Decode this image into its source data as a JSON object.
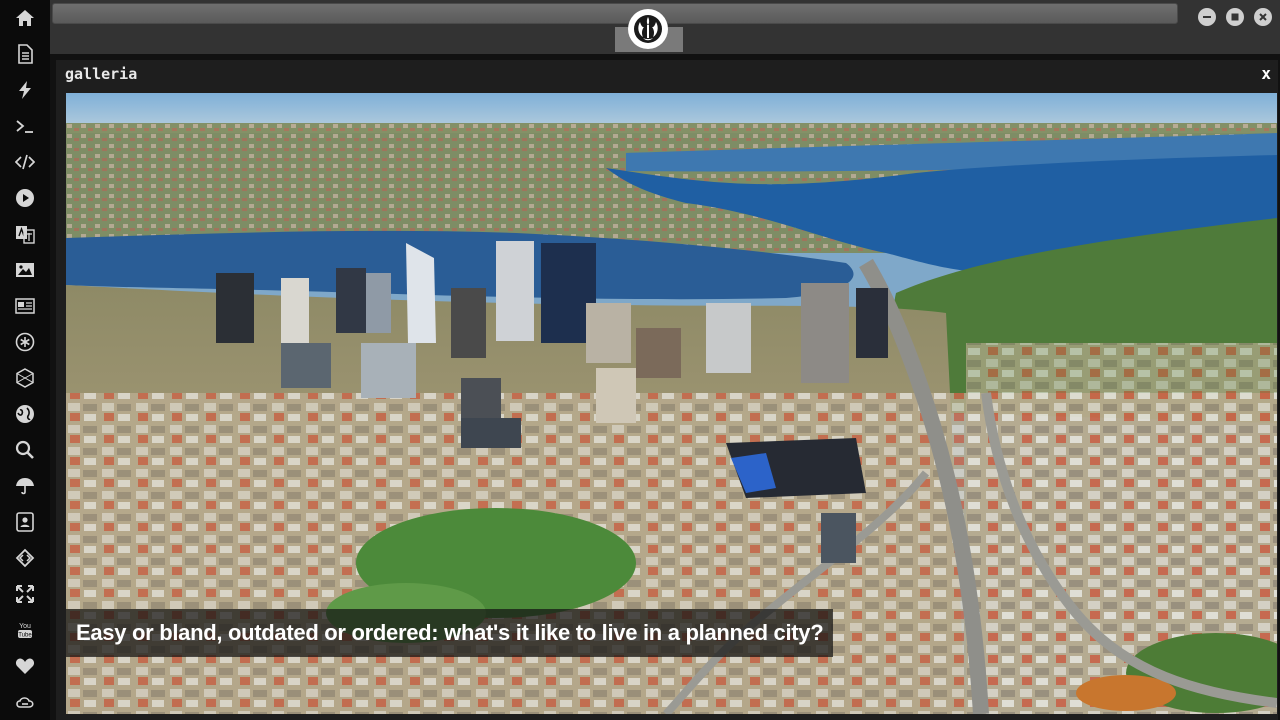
{
  "window": {
    "title": "galleria",
    "close_label": "x"
  },
  "gallery": {
    "caption": "Easy or bland, outdated or ordered: what's it like to live in a planned city?",
    "image_subject": "aerial-city-skyline-photo"
  },
  "sidebar": {
    "icons": [
      "home-icon",
      "document-icon",
      "bolt-icon",
      "terminal-icon",
      "code-icon",
      "play-icon",
      "translate-icon",
      "image-icon",
      "newspaper-icon",
      "asterisk-icon",
      "hexagon-icon",
      "globe-icon",
      "search-icon",
      "umbrella-icon",
      "contact-card-icon",
      "diamond-code-icon",
      "expand-icon",
      "youtube-icon",
      "heart-icon",
      "cloud-link-icon"
    ]
  },
  "colors": {
    "sidebar_bg": "#0b0b0b",
    "topbar_bg": "#333333",
    "panel_bg": "#1e1e1e",
    "icon": "#d6d6d6"
  }
}
